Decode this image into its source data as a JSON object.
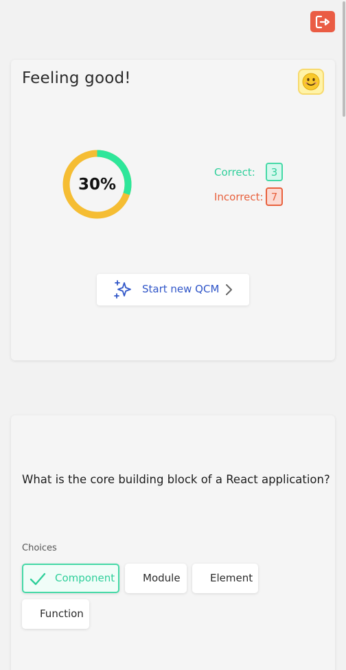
{
  "header": {
    "logout_icon": "logout-icon",
    "logout_color": "#ea5c44"
  },
  "score_card": {
    "mood_title": "Feeling good!",
    "mood_emoji": "😊",
    "score_percent": 30,
    "score_label": "30%",
    "correct_label": "Correct:",
    "correct_count": "3",
    "incorrect_label": "Incorrect:",
    "incorrect_count": "7",
    "start_button_label": "Start new QCM",
    "colors": {
      "correct": "#2ecf9a",
      "incorrect": "#e8603c",
      "ring_track": "#f5bd33",
      "ring_progress": "#2ee69a",
      "accent": "#2f55c8"
    }
  },
  "question_card": {
    "question": "What is the core building block of a React application?",
    "choices_label": "Choices",
    "choices": [
      {
        "label": "Component",
        "selected": true
      },
      {
        "label": "Module",
        "selected": false
      },
      {
        "label": "Element",
        "selected": false
      },
      {
        "label": "Function",
        "selected": false
      }
    ]
  }
}
